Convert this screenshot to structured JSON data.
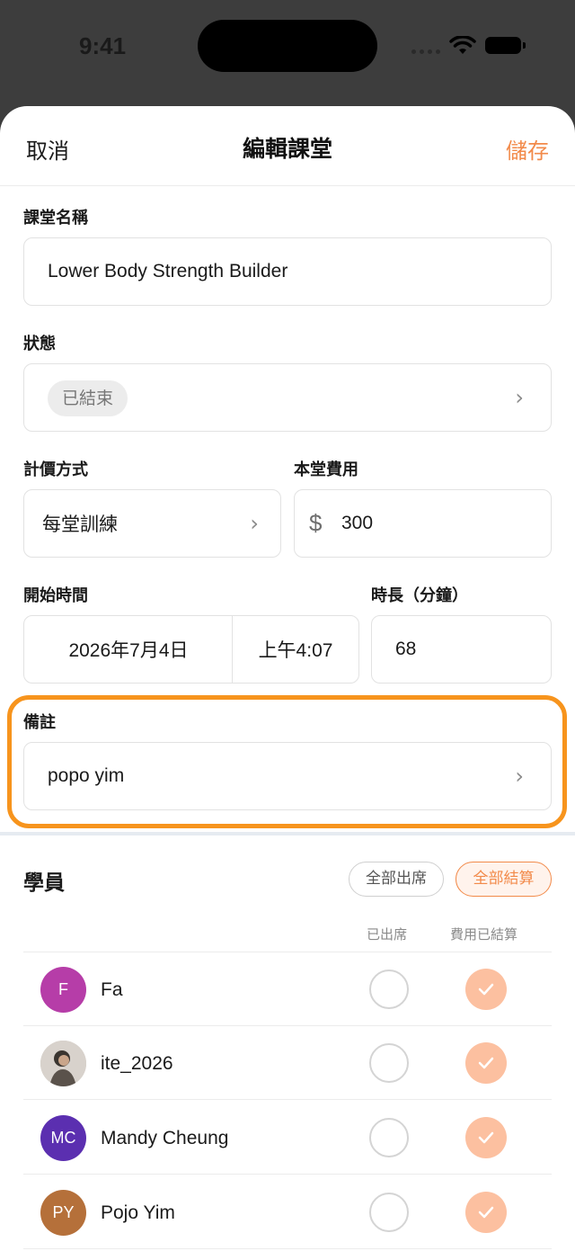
{
  "status_bar": {
    "time": "9:41"
  },
  "header": {
    "cancel_label": "取消",
    "title": "編輯課堂",
    "save_label": "儲存"
  },
  "form": {
    "class_name": {
      "label": "課堂名稱",
      "value": "Lower Body Strength Builder"
    },
    "status": {
      "label": "狀態",
      "value": "已結束"
    },
    "pricing": {
      "label": "計價方式",
      "value": "每堂訓練"
    },
    "fee": {
      "label": "本堂費用",
      "currency_symbol": "$",
      "value": "300"
    },
    "start_time": {
      "label": "開始時間",
      "date": "2026年7月4日",
      "time": "上午4:07"
    },
    "duration": {
      "label": "時長（分鐘）",
      "value": "68"
    },
    "notes": {
      "label": "備註",
      "value": "popo yim"
    }
  },
  "students": {
    "title": "學員",
    "all_attend_label": "全部出席",
    "all_settle_label": "全部結算",
    "col_attended": "已出席",
    "col_fee_settled": "費用已結算",
    "rows": [
      {
        "initials": "F",
        "name": "Fa",
        "avatar_color": "#b63da8",
        "attended": false,
        "settled": true
      },
      {
        "initials": "",
        "name": "ite_2026",
        "avatar_color": "#9a8f86",
        "attended": false,
        "settled": true
      },
      {
        "initials": "MC",
        "name": "Mandy Cheung",
        "avatar_color": "#5b2fb0",
        "attended": false,
        "settled": true
      },
      {
        "initials": "PY",
        "name": "Pojo Yim",
        "avatar_color": "#b5703a",
        "attended": false,
        "settled": true
      }
    ]
  },
  "colors": {
    "accent": "#f28a4a",
    "highlight": "#f7941d",
    "check_fill": "#fcc0a0"
  },
  "icons": [
    "wifi-icon",
    "battery-icon",
    "chevron-right-icon",
    "dollar-icon",
    "check-icon"
  ]
}
